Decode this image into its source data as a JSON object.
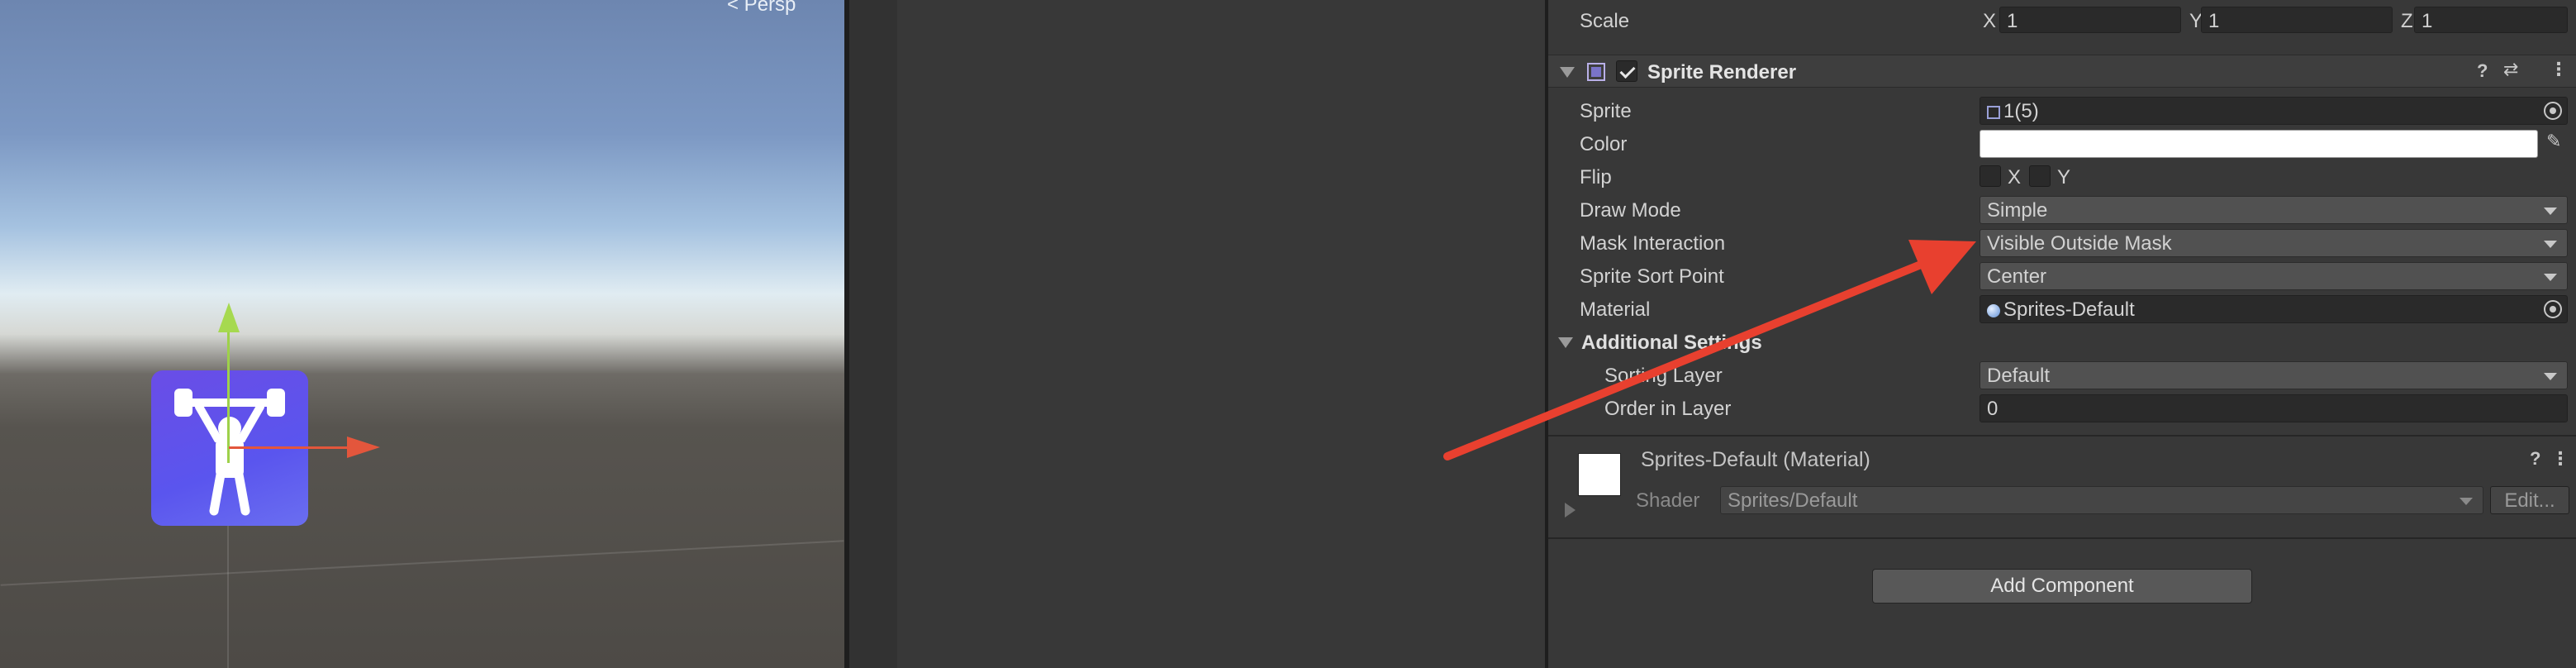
{
  "scene": {
    "persp_label": "< Persp",
    "icon_name": "weightlifter-icon"
  },
  "transform": {
    "scale_label": "Scale",
    "x_label": "X",
    "x_value": "1",
    "y_label": "Y",
    "y_value": "1",
    "z_label": "Z",
    "z_value": "1"
  },
  "sprite_renderer": {
    "title": "Sprite Renderer",
    "enabled": true,
    "fields": {
      "sprite_label": "Sprite",
      "sprite_value": "1(5)",
      "color_label": "Color",
      "color_value": "#ffffff",
      "flip_label": "Flip",
      "flip_x": "X",
      "flip_y": "Y",
      "draw_mode_label": "Draw Mode",
      "draw_mode_value": "Simple",
      "mask_label": "Mask Interaction",
      "mask_value": "Visible Outside Mask",
      "sort_point_label": "Sprite Sort Point",
      "sort_point_value": "Center",
      "material_label": "Material",
      "material_value": "Sprites-Default"
    },
    "additional": {
      "title": "Additional Settings",
      "sorting_layer_label": "Sorting Layer",
      "sorting_layer_value": "Default",
      "order_label": "Order in Layer",
      "order_value": "0"
    }
  },
  "material": {
    "title": "Sprites-Default (Material)",
    "shader_label": "Shader",
    "shader_value": "Sprites/Default",
    "edit_label": "Edit..."
  },
  "add_component_label": "Add Component",
  "colors": {
    "arrow": "#e8402f",
    "sprite_bg": "#5a55ee",
    "panel": "#383838"
  }
}
